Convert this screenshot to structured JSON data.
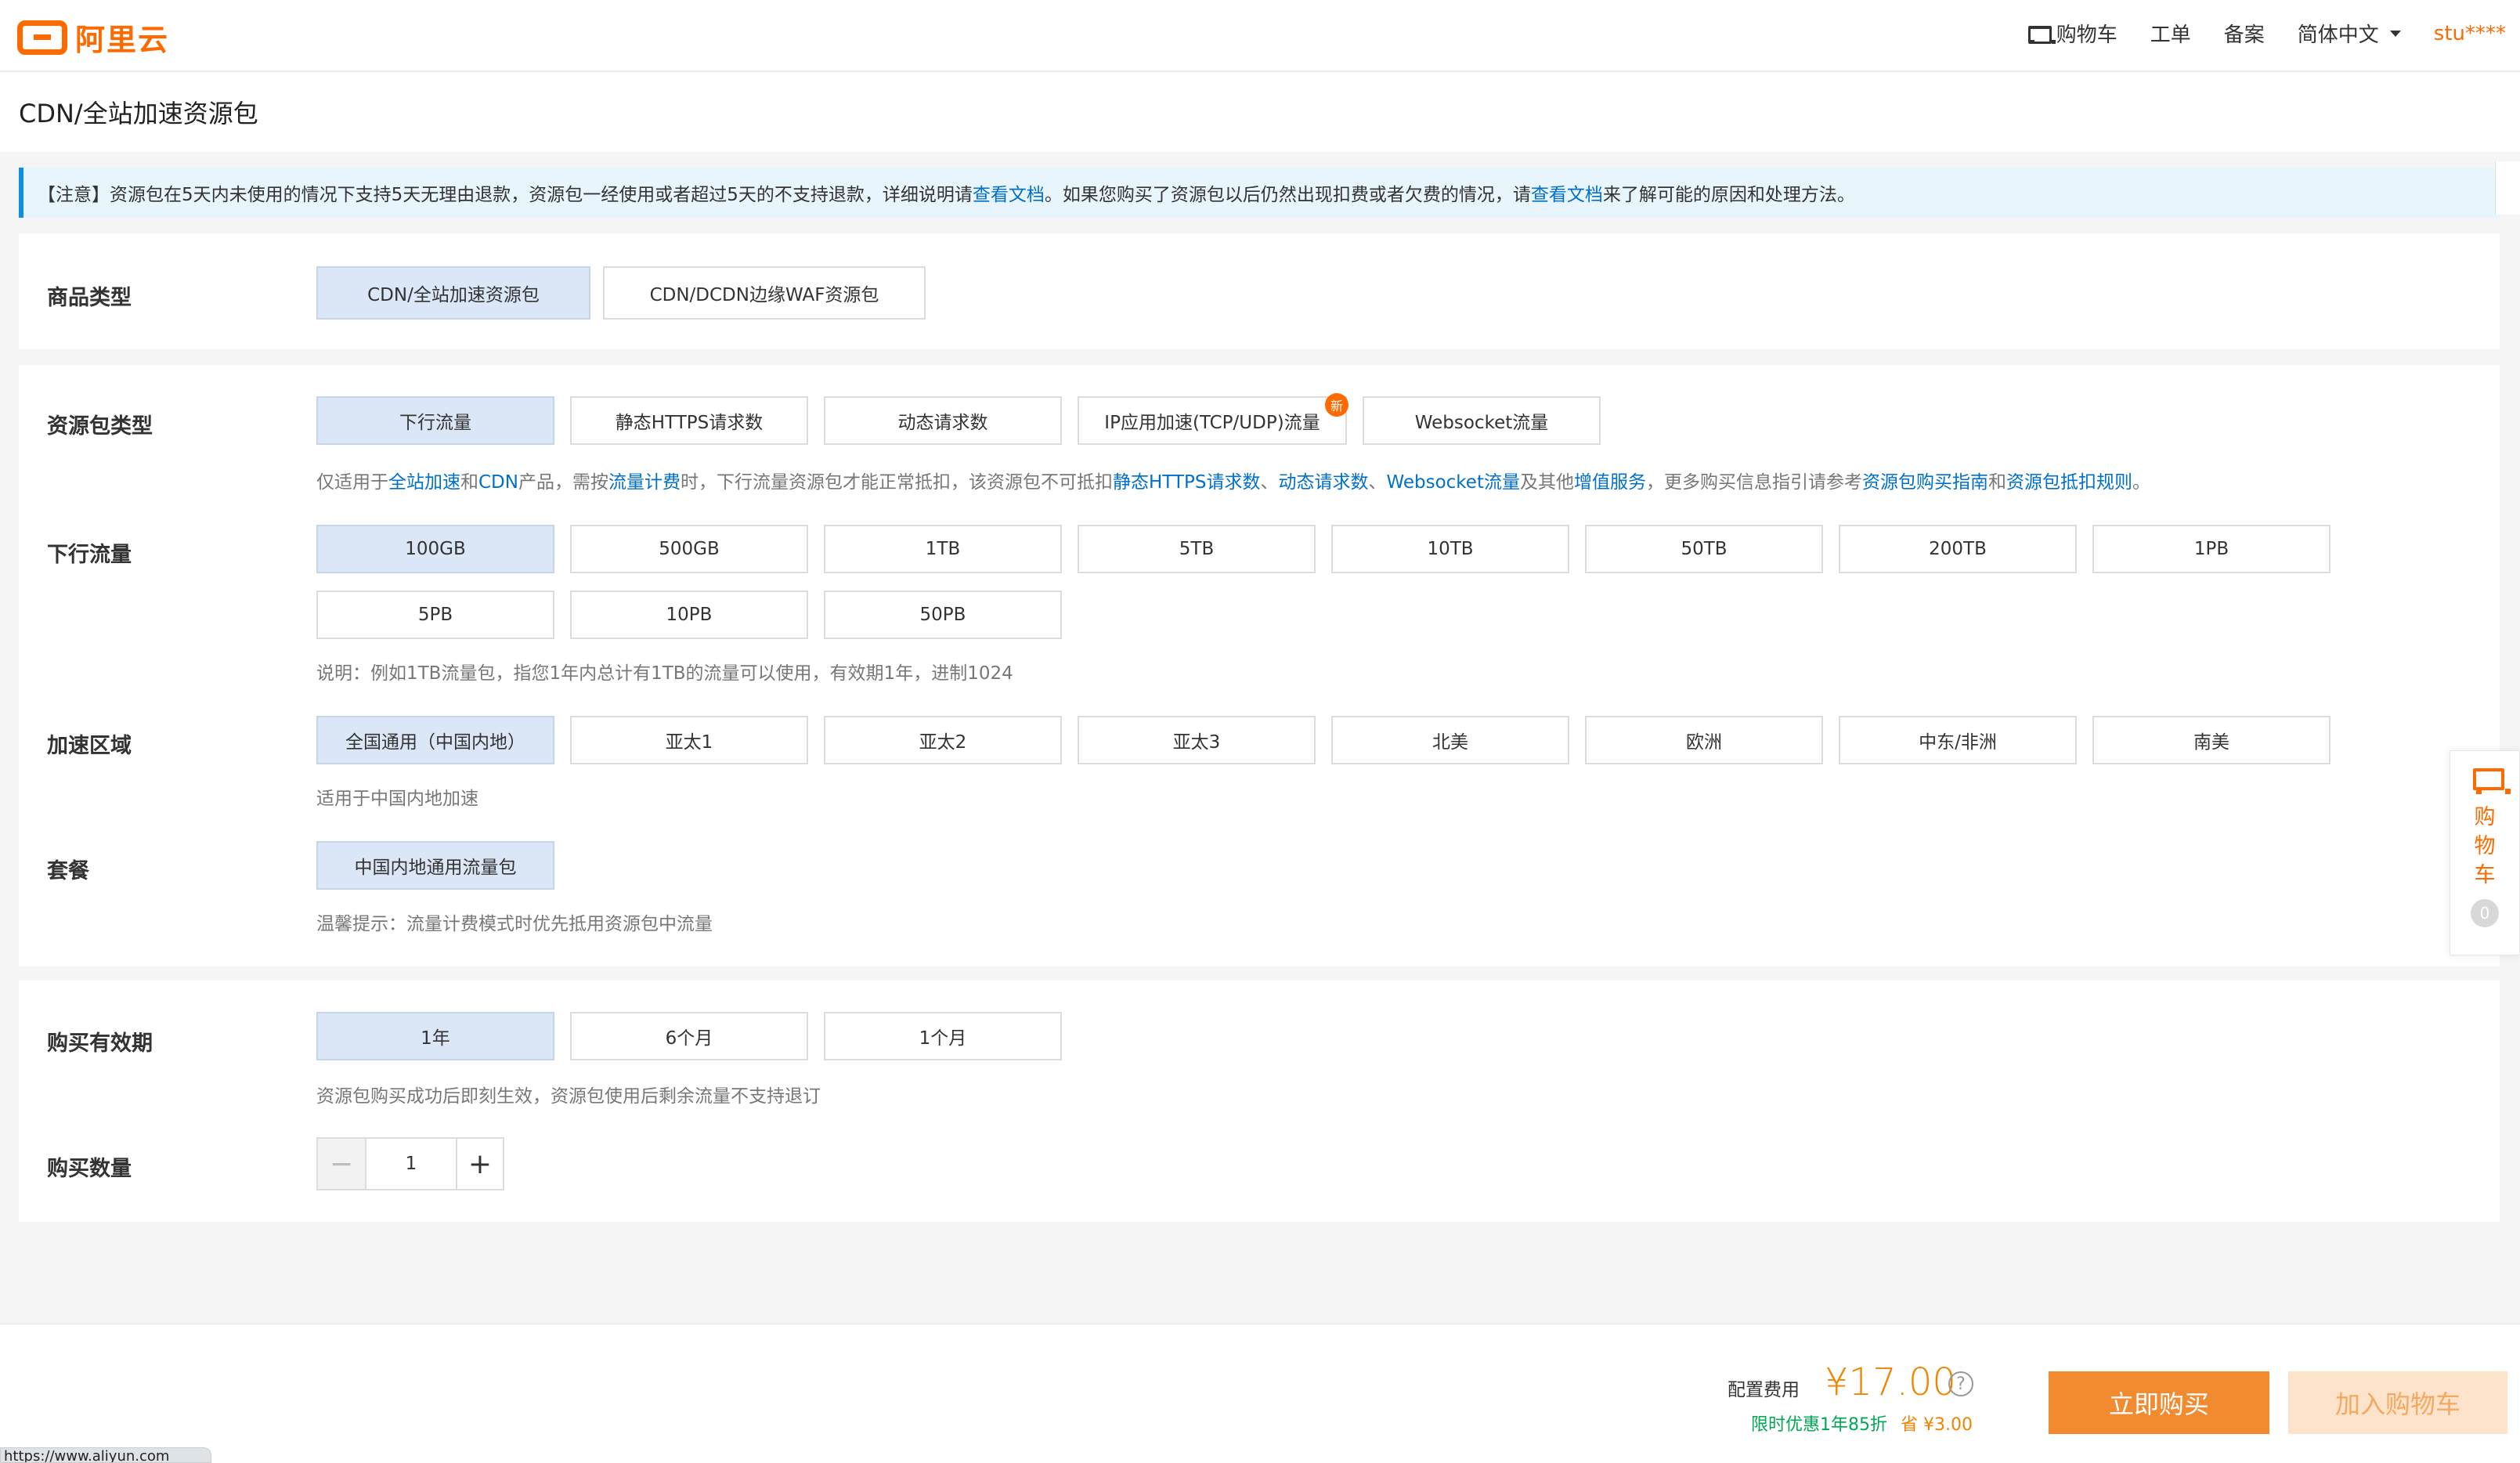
{
  "brand": {
    "logo_text": "阿里云",
    "color": "#ff6a00"
  },
  "nav": {
    "cart": "购物车",
    "ticket": "工单",
    "filing": "备案",
    "language": "简体中文",
    "user": "stu****"
  },
  "page": {
    "title": "CDN/全站加速资源包"
  },
  "notice": {
    "prefix": "【注意】资源包在5天内未使用的情况下支持5天无理由退款，资源包一经使用或者超过5天的不支持退款，详细说明请",
    "link1": "查看文档",
    "middle": "。如果您购买了资源包以后仍然出现扣费或者欠费的情况，请",
    "link2": "查看文档",
    "suffix": "来了解可能的原因和处理方法。"
  },
  "product_type": {
    "label": "商品类型",
    "options": [
      "CDN/全站加速资源包",
      "CDN/DCDN边缘WAF资源包"
    ],
    "selected": 0
  },
  "package_type": {
    "label": "资源包类型",
    "options": [
      "下行流量",
      "静态HTTPS请求数",
      "动态请求数",
      "IP应用加速(TCP/UDP)流量",
      "Websocket流量"
    ],
    "new_badge": "新",
    "selected": 0,
    "hint": {
      "t1": "仅适用于",
      "l1": "全站加速",
      "t2": "和",
      "l2": "CDN",
      "t3": "产品，需按",
      "l3": "流量计费",
      "t4": "时，下行流量资源包才能正常抵扣，该资源包不可抵扣",
      "l4": "静态HTTPS请求数",
      "t5": "、",
      "l5": "动态请求数",
      "t6": "、",
      "l6": "Websocket流量",
      "t7": "及其他",
      "l7": "增值服务",
      "t8": "，更多购买信息指引请参考",
      "l8": "资源包购买指南",
      "t9": "和",
      "l9": "资源包抵扣规则",
      "t10": "。"
    }
  },
  "traffic": {
    "label": "下行流量",
    "options": [
      "100GB",
      "500GB",
      "1TB",
      "5TB",
      "10TB",
      "50TB",
      "200TB",
      "1PB",
      "5PB",
      "10PB",
      "50PB"
    ],
    "selected": 0,
    "hint": "说明：例如1TB流量包，指您1年内总计有1TB的流量可以使用，有效期1年，进制1024"
  },
  "region": {
    "label": "加速区域",
    "options": [
      "全国通用（中国内地）",
      "亚太1",
      "亚太2",
      "亚太3",
      "北美",
      "欧洲",
      "中东/非洲",
      "南美"
    ],
    "selected": 0,
    "hint": "适用于中国内地加速"
  },
  "plan": {
    "label": "套餐",
    "options": [
      "中国内地通用流量包"
    ],
    "selected": 0,
    "hint": "温馨提示：流量计费模式时优先抵用资源包中流量"
  },
  "period": {
    "label": "购买有效期",
    "options": [
      "1年",
      "6个月",
      "1个月"
    ],
    "selected": 0,
    "hint": "资源包购买成功后即刻生效，资源包使用后剩余流量不支持退订"
  },
  "quantity": {
    "label": "购买数量",
    "value": "1",
    "minus": "−",
    "plus": "+"
  },
  "side_cart": {
    "chars": [
      "购",
      "物",
      "车"
    ],
    "count": "0"
  },
  "footer": {
    "cost_label": "配置费用",
    "price": "¥17.00",
    "help": "?",
    "promo": "限时优惠1年85折",
    "save": "省 ¥3.00",
    "buy_now": "立即购买",
    "add_to_cart": "加入购物车"
  },
  "status_url": "https://www.aliyun.com"
}
